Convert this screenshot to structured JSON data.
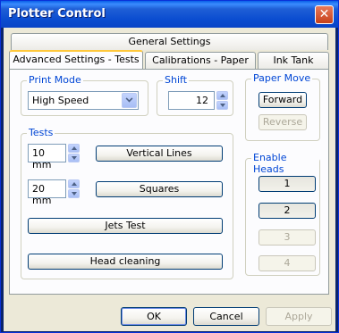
{
  "window": {
    "title": "Plotter Control"
  },
  "tabs": {
    "row_back": [
      {
        "label": "General Settings"
      }
    ],
    "row_front": [
      {
        "label": "Advanced Settings - Tests"
      },
      {
        "label": "Calibrations - Paper"
      },
      {
        "label": "Ink Tank"
      }
    ]
  },
  "print_mode": {
    "label": "Print Mode",
    "value": "High Speed"
  },
  "shift": {
    "label": "Shift",
    "value": "12"
  },
  "paper_move": {
    "label": "Paper Move",
    "forward": "Forward",
    "reverse": "Reverse"
  },
  "tests": {
    "label": "Tests",
    "vertical_lines": {
      "size": "10 mm",
      "button": "Vertical Lines"
    },
    "squares": {
      "size": "20 mm",
      "button": "Squares"
    },
    "jets_test": "Jets Test",
    "head_cleaning": "Head cleaning"
  },
  "enable_heads": {
    "label": "Enable Heads",
    "heads": [
      "1",
      "2",
      "3",
      "4"
    ]
  },
  "footer": {
    "ok": "OK",
    "cancel": "Cancel",
    "apply": "Apply"
  }
}
